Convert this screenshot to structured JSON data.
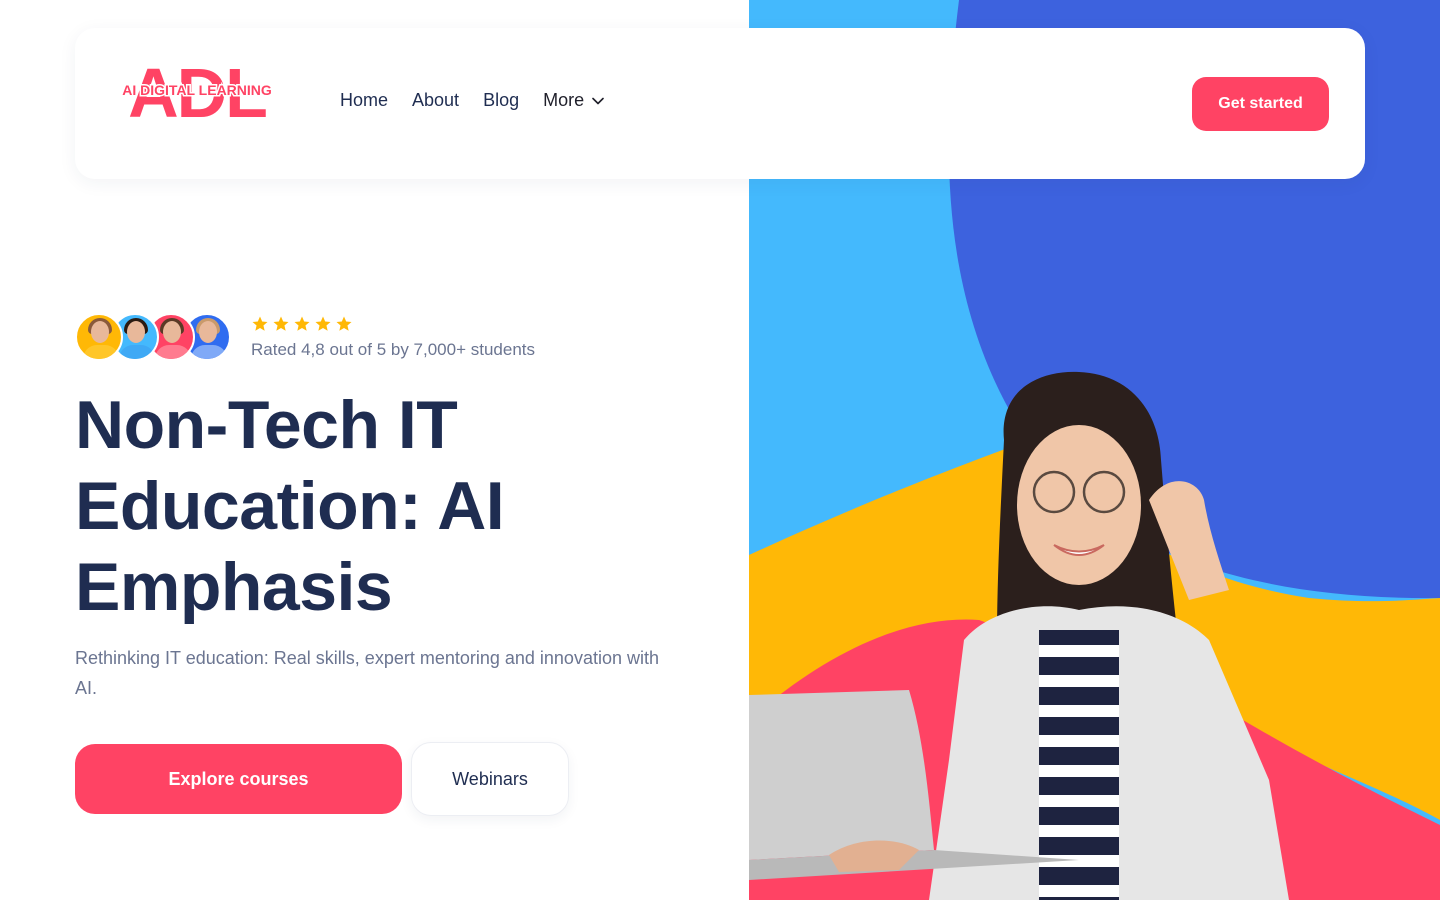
{
  "brand": {
    "logo_main": "ADL",
    "logo_sub": "AI DIGITAL LEARNING",
    "colors": {
      "primary": "#ff4364",
      "navy": "#1f2d51",
      "muted": "#6b7591",
      "sky": "#44b9fd",
      "royal": "#3d62de",
      "amber": "#ffb806",
      "star": "#ffb806"
    }
  },
  "nav": {
    "items": [
      {
        "label": "Home"
      },
      {
        "label": "About"
      },
      {
        "label": "Blog"
      },
      {
        "label": "More",
        "icon": "chevron-down-icon"
      }
    ],
    "cta_label": "Get started"
  },
  "social_proof": {
    "avatars": [
      {
        "name": "student-1",
        "bg": "#ffb806",
        "shirt": "#ffc629",
        "hair": "#8a5a3b"
      },
      {
        "name": "student-2",
        "bg": "#44b9fd",
        "shirt": "#3fa9f5",
        "hair": "#2b1b12"
      },
      {
        "name": "student-3",
        "bg": "#ff4364",
        "shirt": "#ff7b8f",
        "hair": "#5a3a26"
      },
      {
        "name": "student-4",
        "bg": "#2f6cf0",
        "shirt": "#7fa9f7",
        "hair": "#c99a6b"
      }
    ],
    "stars": 5,
    "rating_text": "Rated 4,8 out of 5 by 7,000+ students"
  },
  "hero": {
    "headline_lines": [
      "Non-Tech IT",
      "Education: AI",
      "Emphasis"
    ],
    "subtitle": "Rethinking IT education: Real skills, expert mentoring and innovation with AI.",
    "primary_button": "Explore courses",
    "secondary_button": "Webinars",
    "image_alt": "smiling woman with glasses holding a laptop"
  }
}
